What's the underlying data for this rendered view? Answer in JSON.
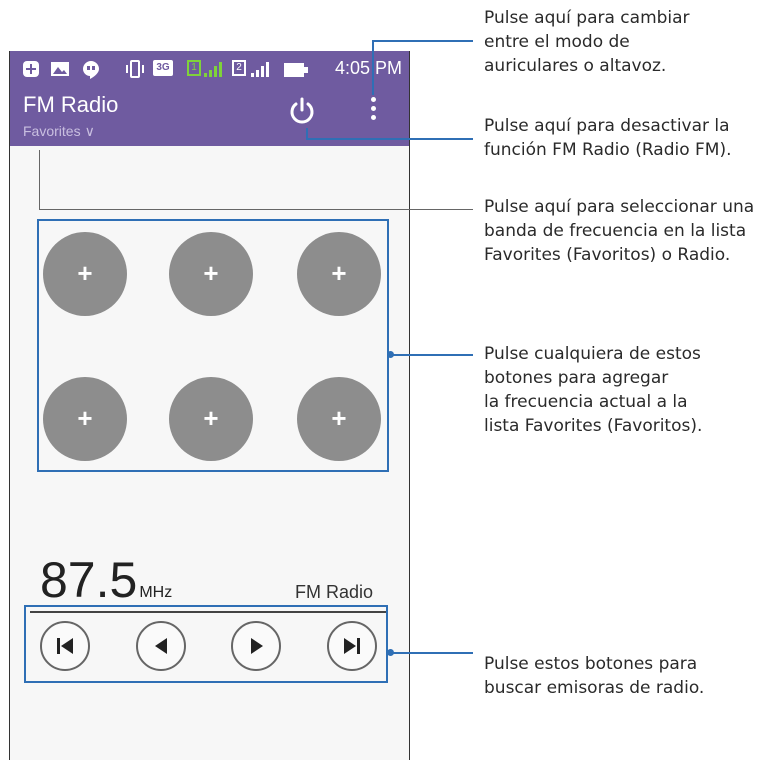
{
  "status_bar": {
    "time": "4:05 PM",
    "sim1": "1",
    "sim2": "2",
    "network": "3G",
    "icons": [
      "add-icon",
      "image-icon",
      "hangouts-icon",
      "vibrate-icon",
      "3g-icon",
      "sim1-signal-icon",
      "sim2-signal-icon",
      "battery-icon"
    ]
  },
  "app_bar": {
    "title": "FM Radio",
    "subtitle": "Favorites",
    "subtitle_chevron": "∨",
    "power_icon": "power-icon",
    "menu_icon": "overflow-menu-icon"
  },
  "favorites": {
    "button_label": "+",
    "count": 6
  },
  "tuner": {
    "frequency": "87.5",
    "unit": "MHz",
    "station": "FM Radio"
  },
  "controls": [
    "skip-previous-icon",
    "seek-back-icon",
    "seek-forward-icon",
    "skip-next-icon"
  ],
  "annotations": {
    "speaker_mode": "Pulse aquí para cambiar\nentre el modo de\nauriculares o altavoz.",
    "power_off": "Pulse aquí para desactivar la\nfunción FM Radio (Radio FM).",
    "band_select": "Pulse aquí para seleccionar una\nbanda de frecuencia en la lista\nFavorites (Favoritos) o Radio.",
    "add_favorites": "Pulse cualquiera de estos\nbotones para agregar\nla frecuencia actual a la\nlista Favorites (Favoritos).",
    "search_stations": "Pulse estos botones para\nbuscar emisoras de radio."
  },
  "colors": {
    "app_bar": "#6f5ba0",
    "highlight": "#2f6fb5",
    "fav_button": "#8d8d8d",
    "signal_green": "#7fd23a"
  }
}
